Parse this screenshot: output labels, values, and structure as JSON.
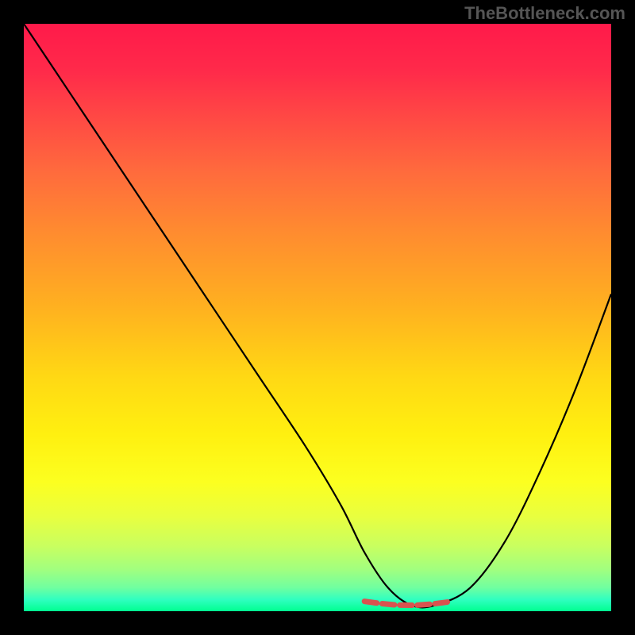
{
  "watermark": "TheBottleneck.com",
  "chart_data": {
    "type": "line",
    "title": "",
    "xlabel": "",
    "ylabel": "",
    "xlim": [
      0,
      100
    ],
    "ylim": [
      0,
      100
    ],
    "grid": false,
    "series": [
      {
        "name": "curve",
        "x": [
          0,
          8,
          16,
          24,
          32,
          40,
          48,
          54,
          58,
          62,
          66,
          70,
          76,
          82,
          88,
          94,
          100
        ],
        "y": [
          100,
          88,
          76,
          64,
          52,
          40,
          28,
          18,
          10,
          4,
          1,
          1,
          4,
          12,
          24,
          38,
          54
        ]
      }
    ],
    "highlight": {
      "name": "bottleneck-range",
      "x_range": [
        58,
        73
      ],
      "y": 1,
      "color": "#d9534f"
    },
    "background_gradient": {
      "top": "#ff1a4a",
      "mid": "#ffe010",
      "bottom": "#00ff90"
    }
  }
}
